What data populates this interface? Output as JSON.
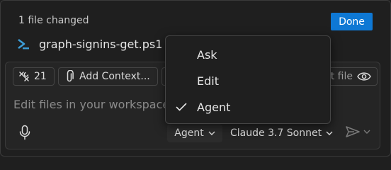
{
  "header": {
    "changed_text": "1 file changed",
    "done_label": "Done",
    "file_name": "graph-signins-get.ps1"
  },
  "input": {
    "tools_count": "21",
    "add_context_label": "Add Context...",
    "current_file_label": "t file",
    "placeholder": "Edit files in your workspace"
  },
  "footer": {
    "mode_label": "Agent",
    "model_label": "Claude 3.7 Sonnet"
  },
  "mode_menu": {
    "items": [
      {
        "label": "Ask",
        "checked": false
      },
      {
        "label": "Edit",
        "checked": false
      },
      {
        "label": "Agent",
        "checked": true
      }
    ]
  },
  "colors": {
    "accent": "#0e78d4",
    "powershell_icon": "#3c9cd6"
  }
}
